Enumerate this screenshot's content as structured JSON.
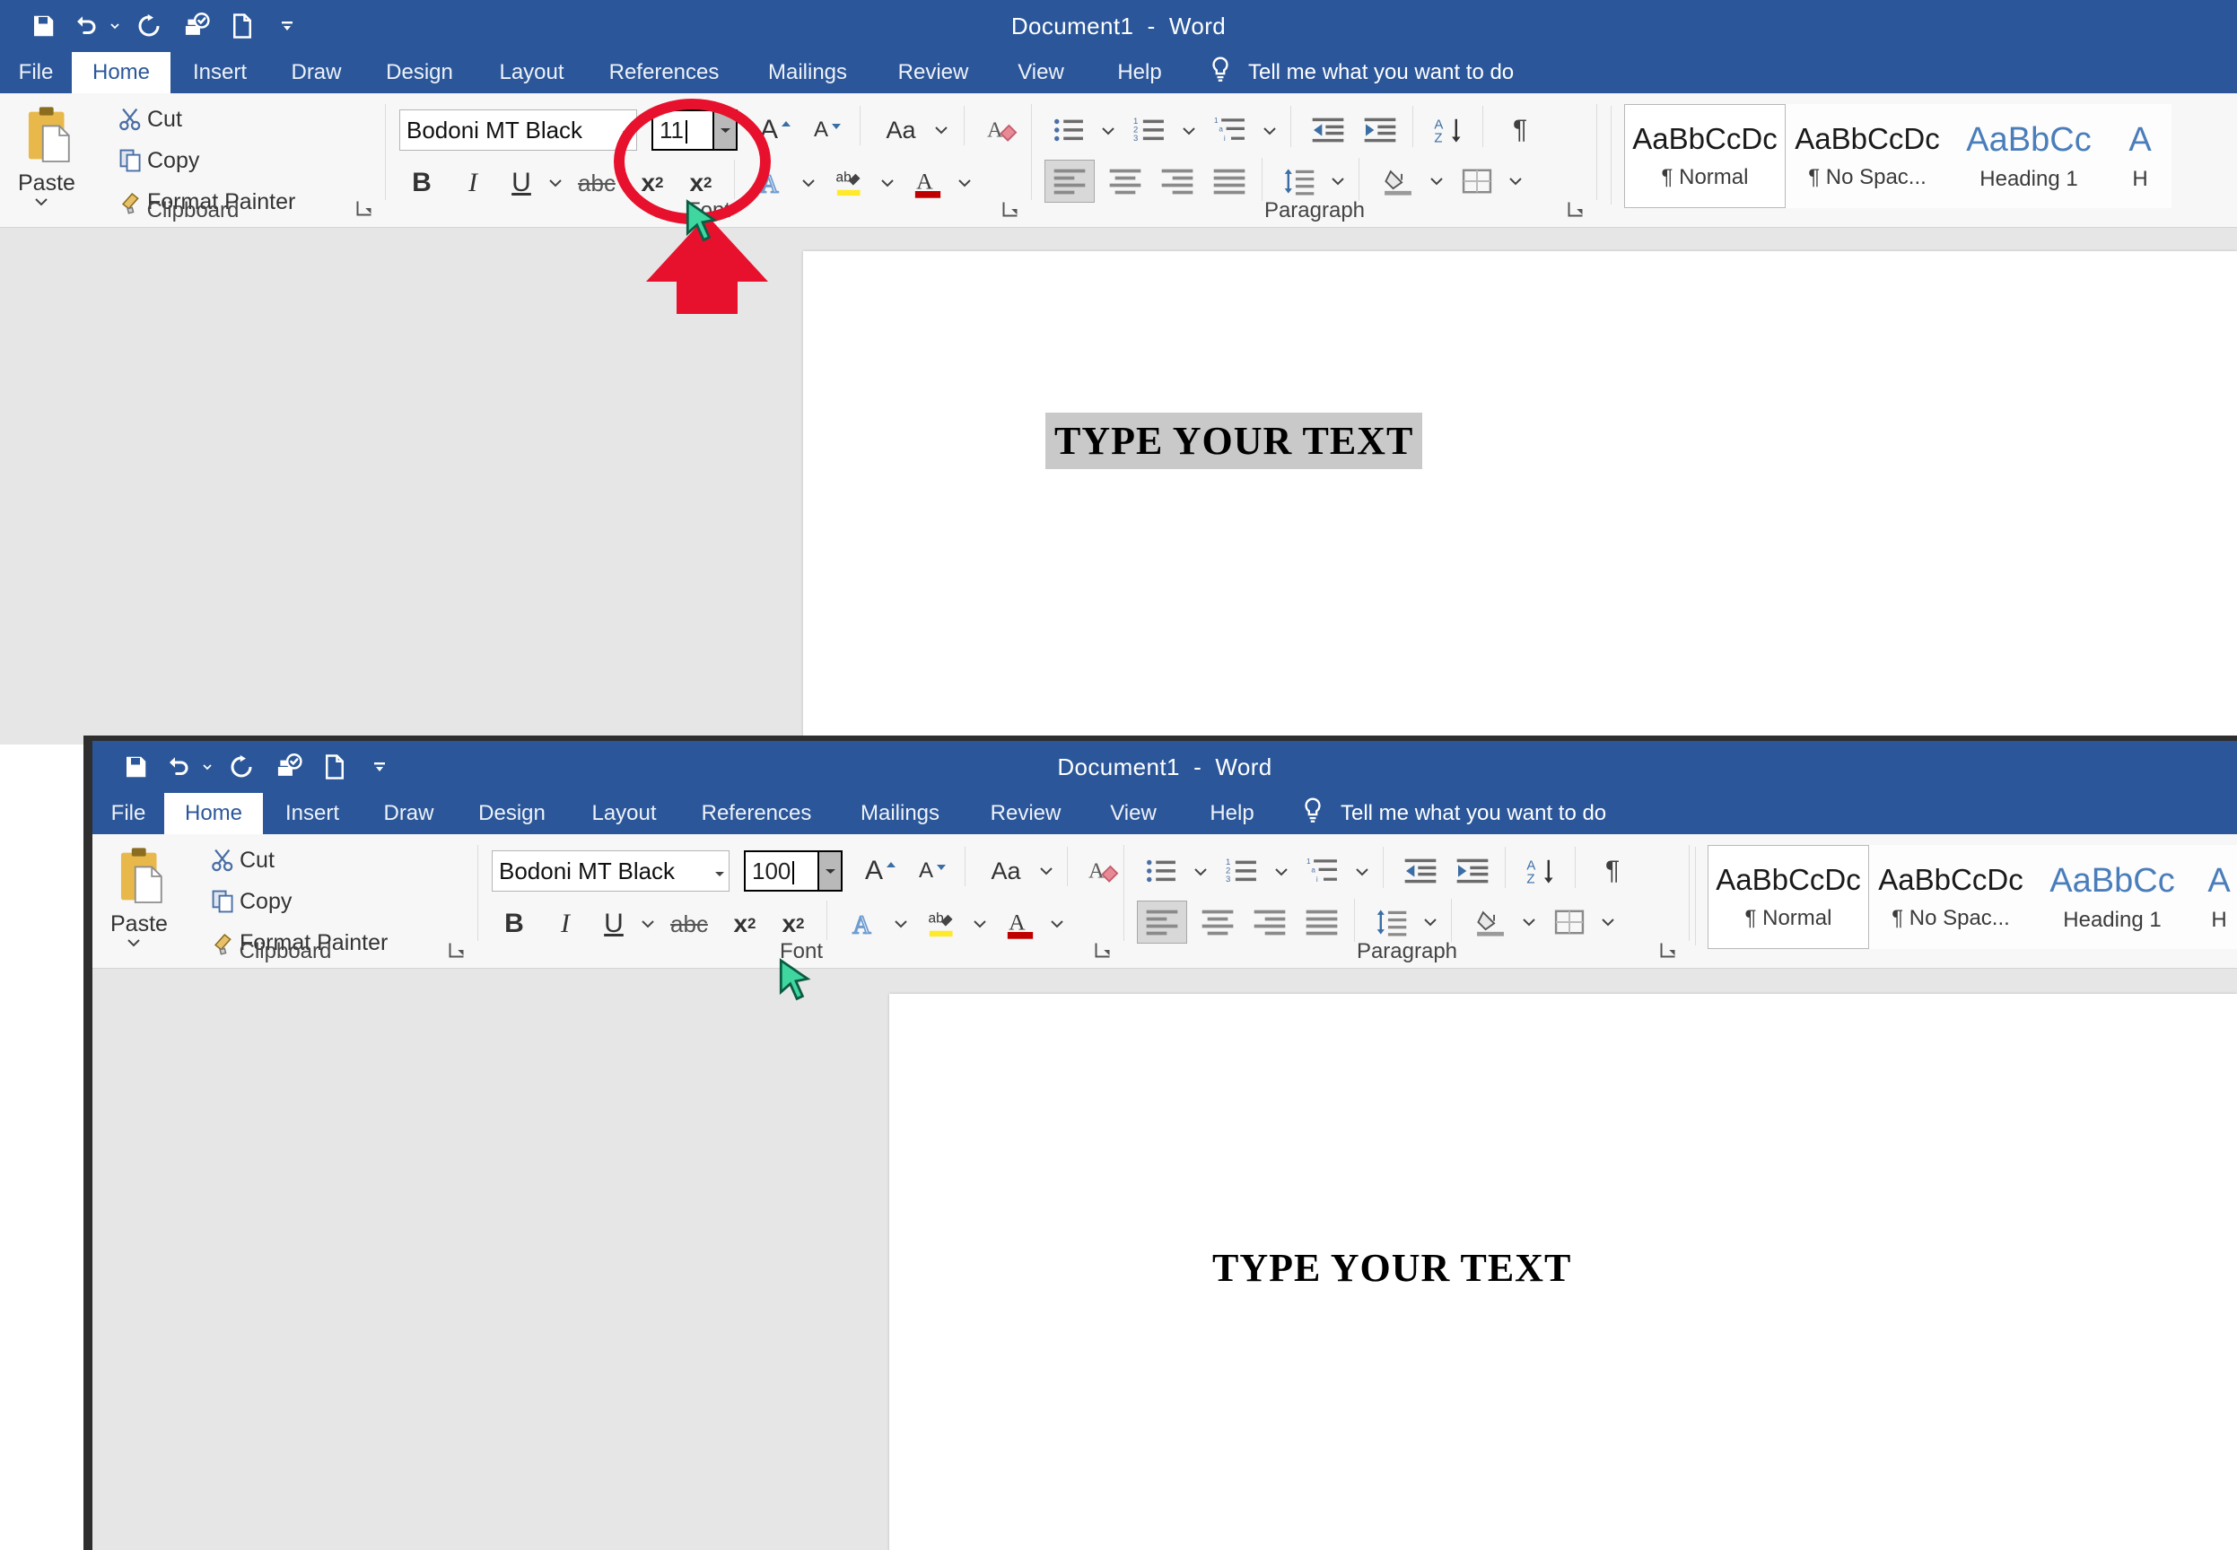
{
  "windows": [
    {
      "id": "top-window",
      "title": "Document1  -  Word",
      "quick_access": [
        "save-icon",
        "undo-icon",
        "undo-dropdown-icon",
        "redo-icon",
        "print-preview-icon",
        "new-document-icon",
        "customize-qat-icon"
      ],
      "tabs": [
        "File",
        "Home",
        "Insert",
        "Draw",
        "Design",
        "Layout",
        "References",
        "Mailings",
        "Review",
        "View",
        "Help"
      ],
      "active_tab": "Home",
      "tell_me": "Tell me what you want to do",
      "clipboard": {
        "paste_label": "Paste",
        "cut_label": "Cut",
        "copy_label": "Copy",
        "format_painter_label": "Format Painter",
        "group_label": "Clipboard"
      },
      "font": {
        "family": "Bodoni MT Black",
        "size": "11",
        "group_label": "Font",
        "grow_label": "A",
        "shrink_label": "A",
        "change_case_label": "Aa",
        "bold": "B",
        "italic": "I",
        "underline": "U",
        "strikethrough": "abc",
        "subscript": "x",
        "subscript_sub": "2",
        "superscript": "x",
        "superscript_sup": "2"
      },
      "paragraph": {
        "group_label": "Paragraph"
      },
      "styles": [
        {
          "preview": "AaBbCcDc",
          "name": "¶ Normal",
          "selected": true
        },
        {
          "preview": "AaBbCcDc",
          "name": "¶ No Spac...",
          "selected": false
        },
        {
          "preview": "AaBbCc",
          "name": "Heading 1",
          "selected": false
        },
        {
          "preview": "A",
          "name": "H",
          "selected": false
        }
      ],
      "document_text": "TYPE YOUR TEXT",
      "document_text_selected": true
    },
    {
      "id": "bottom-window",
      "title": "Document1  -  Word",
      "quick_access": [
        "save-icon",
        "undo-icon",
        "undo-dropdown-icon",
        "redo-icon",
        "print-preview-icon",
        "new-document-icon",
        "customize-qat-icon"
      ],
      "tabs": [
        "File",
        "Home",
        "Insert",
        "Draw",
        "Design",
        "Layout",
        "References",
        "Mailings",
        "Review",
        "View",
        "Help"
      ],
      "active_tab": "Home",
      "tell_me": "Tell me what you want to do",
      "clipboard": {
        "paste_label": "Paste",
        "cut_label": "Cut",
        "copy_label": "Copy",
        "format_painter_label": "Format Painter",
        "group_label": "Clipboard"
      },
      "font": {
        "family": "Bodoni MT Black",
        "size": "100",
        "group_label": "Font",
        "grow_label": "A",
        "shrink_label": "A",
        "change_case_label": "Aa",
        "bold": "B",
        "italic": "I",
        "underline": "U",
        "strikethrough": "abc",
        "subscript": "x",
        "subscript_sub": "2",
        "superscript": "x",
        "superscript_sup": "2"
      },
      "paragraph": {
        "group_label": "Paragraph"
      },
      "styles": [
        {
          "preview": "AaBbCcDc",
          "name": "¶ Normal",
          "selected": true
        },
        {
          "preview": "AaBbCcDc",
          "name": "¶ No Spac...",
          "selected": false
        },
        {
          "preview": "AaBbCc",
          "name": "Heading 1",
          "selected": false
        },
        {
          "preview": "A",
          "name": "H",
          "selected": false
        }
      ],
      "document_text": "TYPE YOUR TEXT",
      "document_text_selected": false
    }
  ],
  "annotations": {
    "highlight_ring": "red-ellipse-around-font-size-box",
    "pointer_arrow": "red-arrow-pointing-up-at-font-size-box",
    "ring_color": "#e8112d",
    "arrow_color": "#e8112d"
  },
  "colors": {
    "ribbon_blue": "#2b579a",
    "ribbon_bg": "#f7f7f7",
    "canvas_gray": "#e6e6e6",
    "selection_gray": "#c9c9c9",
    "accent_red": "#e8112d"
  }
}
